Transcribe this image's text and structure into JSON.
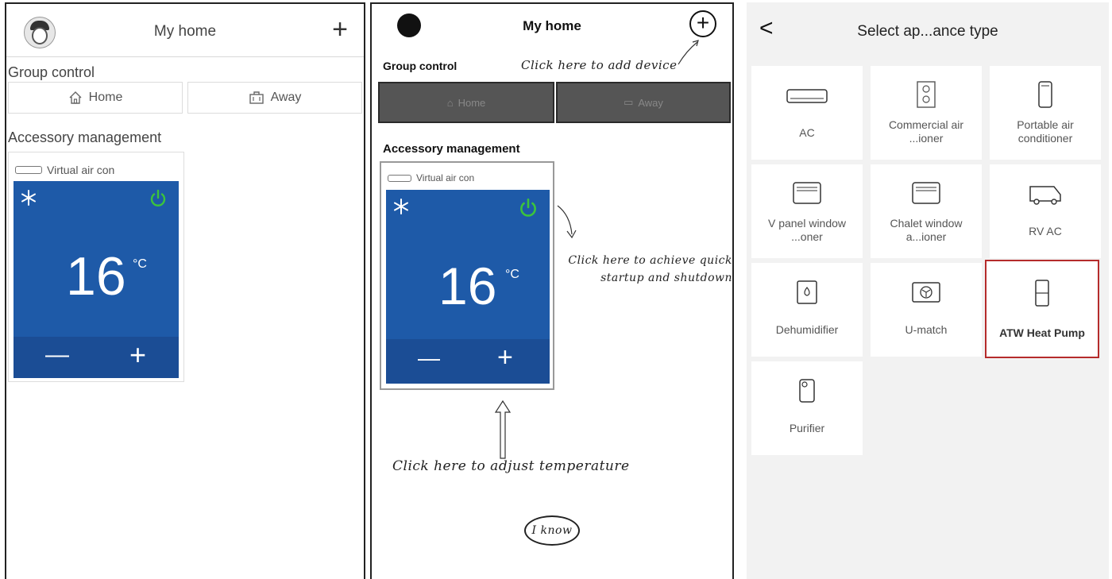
{
  "screen1": {
    "title": "My home",
    "add_icon": "plus-icon",
    "group_control": "Group control",
    "home_btn": "Home",
    "away_btn": "Away",
    "accessory": "Accessory management",
    "device_name": "Virtual air con",
    "temperature": "16",
    "unit": "°C",
    "minus": "—",
    "plus": "+"
  },
  "screen2": {
    "title": "My home",
    "group_control": "Group control",
    "home_btn": "Home",
    "away_btn": "Away",
    "accessory": "Accessory management",
    "device_name": "Virtual air con",
    "temperature": "16",
    "unit": "°C",
    "minus": "—",
    "plus": "+",
    "hint_add": "Click here to add device",
    "hint_power": "Click here to achieve quick startup and shutdown",
    "hint_temp": "Click here to adjust temperature",
    "i_know": "I know"
  },
  "screen3": {
    "title": "Select ap...ance type",
    "back": "<",
    "tiles": [
      {
        "label": "AC"
      },
      {
        "label": "Commercial air ...ioner"
      },
      {
        "label": "Portable air conditioner"
      },
      {
        "label": "V panel window ...oner"
      },
      {
        "label": "Chalet window a...ioner"
      },
      {
        "label": "RV AC"
      },
      {
        "label": "Dehumidifier"
      },
      {
        "label": "U-match"
      },
      {
        "label": "ATW Heat Pump",
        "selected": true
      },
      {
        "label": "Purifier"
      }
    ]
  },
  "colors": {
    "card_blue": "#1e5aa8",
    "power_green": "#3cc43c",
    "highlight_red": "#b52b2b"
  }
}
